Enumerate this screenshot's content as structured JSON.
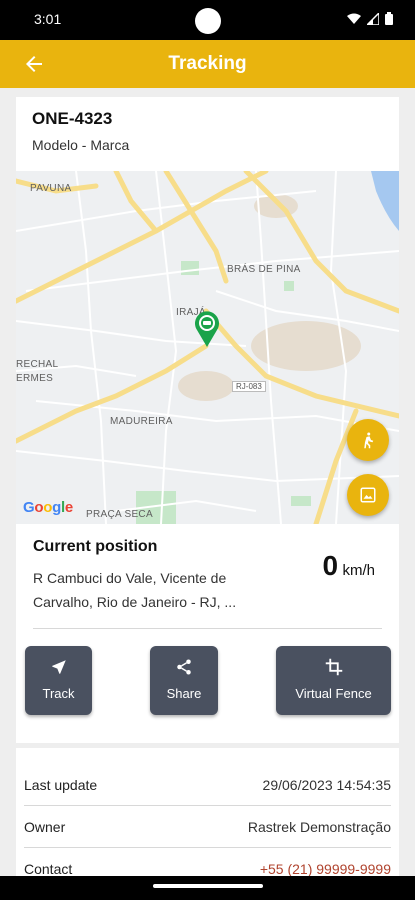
{
  "status_bar": {
    "time": "3:01"
  },
  "app_bar": {
    "title": "Tracking",
    "back_icon": "arrow-left-icon"
  },
  "vehicle": {
    "plate": "ONE-4323",
    "model": "Modelo - Marca"
  },
  "map": {
    "labels": {
      "pavuna": "PAVUNA",
      "bras_de_pina": "BRÁS DE PINA",
      "iraja": "IRAJÁ",
      "rechal": "RECHAL",
      "ermes": "ERMES",
      "madureira": "MADUREIRA",
      "praca_seca": "PRAÇA SECA",
      "road": "RJ-083"
    },
    "google_logo": "Google",
    "buttons": [
      "pedestrian-icon",
      "image-icon"
    ],
    "colors": {
      "pin": "#1aa34a",
      "fab": "#e9b40e"
    }
  },
  "position": {
    "heading": "Current position",
    "address": "R Cambuci do Vale, Vicente de Carvalho, Rio de Janeiro - RJ, ...",
    "speed": "0",
    "speed_unit": "km/h"
  },
  "actions": {
    "track": "Track",
    "share": "Share",
    "virtual_fence": "Virtual Fence"
  },
  "info": {
    "last_update_label": "Last update",
    "last_update_value": "29/06/2023 14:54:35",
    "owner_label": "Owner",
    "owner_value": "Rastrek Demonstração",
    "contact_label": "Contact",
    "contact_value": "+55 (21) 99999-9999"
  },
  "theme": {
    "accent": "#e9b40e",
    "button": "#4a5160",
    "link": "#b0442f"
  }
}
